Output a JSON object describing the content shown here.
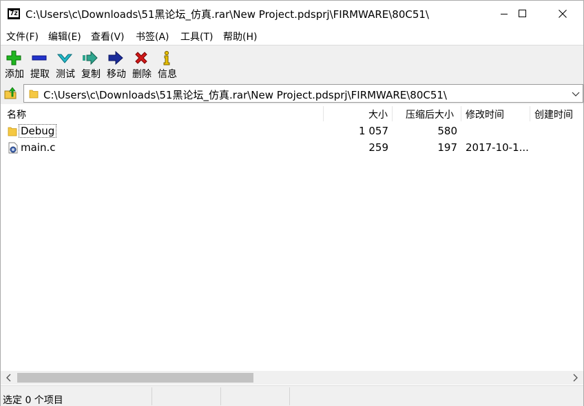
{
  "window": {
    "title": "C:\\Users\\c\\Downloads\\51黑论坛_仿真.rar\\New Project.pdsprj\\FIRMWARE\\80C51\\",
    "app_icon_text": "7z"
  },
  "menu": [
    "文件(F)",
    "编辑(E)",
    "查看(V)",
    "书签(A)",
    "工具(T)",
    "帮助(H)"
  ],
  "toolbar": {
    "add": "添加",
    "extract": "提取",
    "test": "测试",
    "copy": "复制",
    "move": "移动",
    "delete": "删除",
    "info": "信息"
  },
  "address": {
    "path": "C:\\Users\\c\\Downloads\\51黑论坛_仿真.rar\\New Project.pdsprj\\FIRMWARE\\80C51\\"
  },
  "columns": {
    "name": "名称",
    "size": "大小",
    "packed": "压缩后大小",
    "modified": "修改时间",
    "created": "创建时间"
  },
  "files": [
    {
      "name": "Debug",
      "size": "1 057",
      "packed": "580",
      "modified": "",
      "icon": "folder-icon"
    },
    {
      "name": "main.c",
      "size": "259",
      "packed": "197",
      "modified": "2017-10-1...",
      "icon": "c-file-icon"
    }
  ],
  "status": {
    "selected": "选定 0 个项目"
  },
  "colors": {
    "toolbar_bg": "#f0f0f0",
    "add_green": "#1fb51f",
    "extract_blue": "#2233cc",
    "test_cyan": "#22b8c8",
    "delete_red": "#d11a1a",
    "info_yellow": "#e8c000",
    "folder_yellow": "#f5c842"
  }
}
